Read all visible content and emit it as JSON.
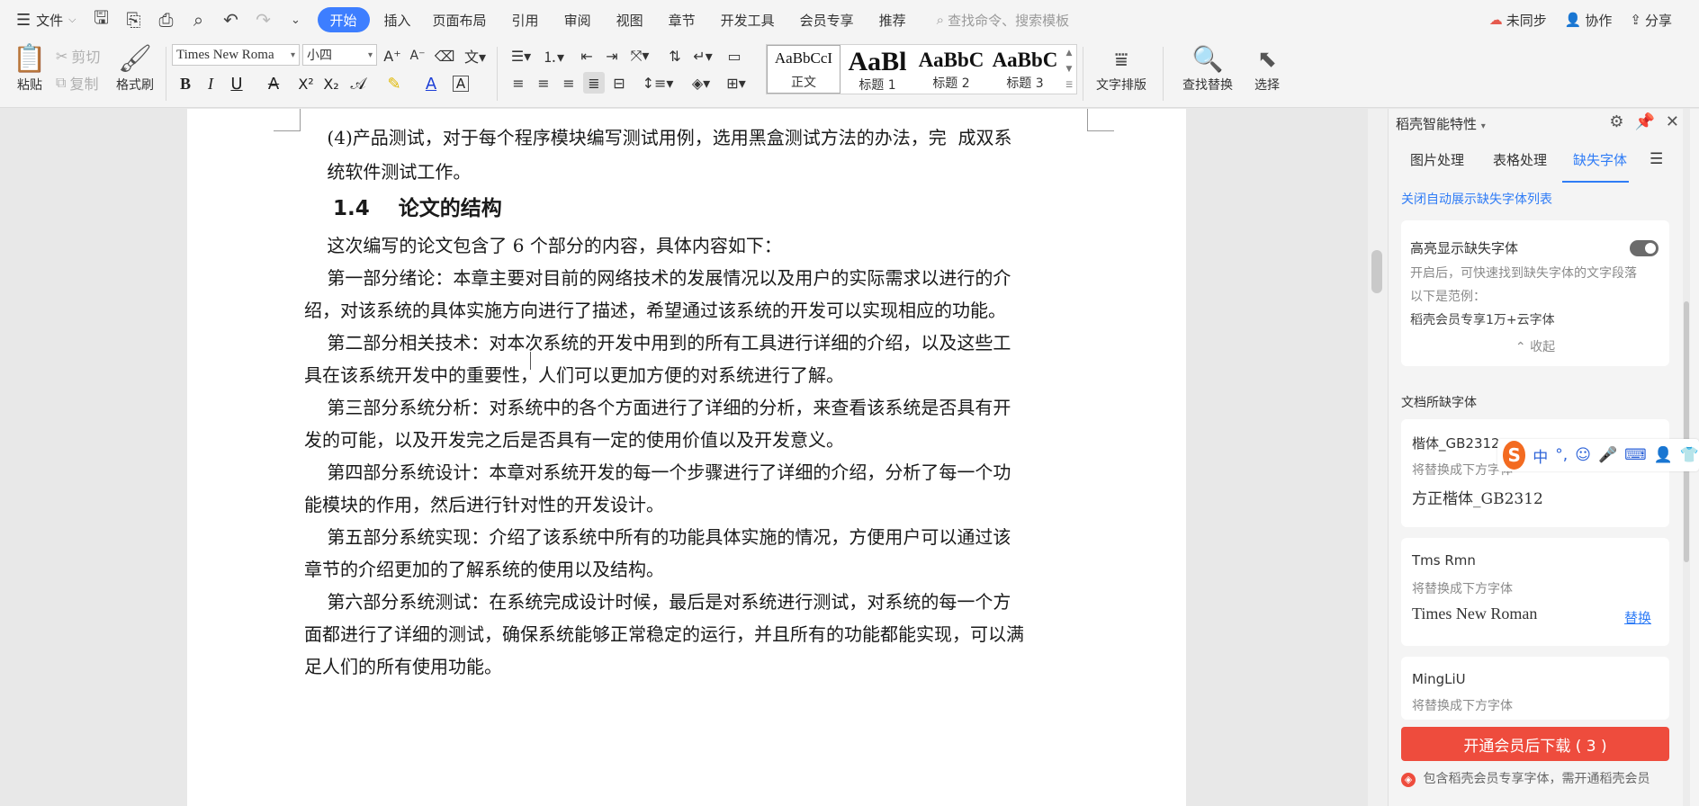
{
  "menubar": {
    "file_label": "文件",
    "tabs": [
      "开始",
      "插入",
      "页面布局",
      "引用",
      "审阅",
      "视图",
      "章节",
      "开发工具",
      "会员专享",
      "推荐"
    ],
    "search_placeholder": "查找命令、搜索模板",
    "sync_label": "未同步",
    "collab_label": "协作",
    "share_label": "分享"
  },
  "ribbon": {
    "paste_label": "粘贴",
    "cut_label": "剪切",
    "copy_label": "复制",
    "format_painter_label": "格式刷",
    "font_name": "Times New Roma",
    "font_size": "小四",
    "styles": [
      {
        "sample": "AaBbCcI",
        "name": "正文"
      },
      {
        "sample": "AaBl",
        "name": "标题 1"
      },
      {
        "sample": "AaBbC",
        "name": "标题 2"
      },
      {
        "sample": "AaBbC",
        "name": "标题 3"
      }
    ],
    "text_layout_label": "文字排版",
    "find_replace_label": "查找替换",
    "select_label": "选择"
  },
  "document": {
    "paragraphs": [
      "    (4)产品测试，对于每个程序模块编写测试用例，选用黑盒测试方法的办法，完  成双系",
      "    统软件测试工作。",
      "    1.4    论文的结构",
      "    这次编写的论文包含了 6 个部分的内容，具体内容如下：",
      "    第一部分绪论：本章主要对目前的网络技术的发展情况以及用户的实际需求以进行的介",
      "绍，对该系统的具体实施方向进行了描述，希望通过该系统的开发可以实现相应的功能。",
      "    第二部分相关技术：对本次系统的开发中用到的所有工具进行详细的介绍，以及这些工",
      "具在该系统开发中的重要性，人们可以更加方便的对系统进行了解。",
      "    第三部分系统分析：对系统中的各个方面进行了详细的分析，来查看该系统是否具有开",
      "发的可能，以及开发完之后是否具有一定的使用价值以及开发意义。",
      "    第四部分系统设计：本章对系统开发的每一个步骤进行了详细的介绍，分析了每一个功",
      "能模块的作用，然后进行针对性的开发设计。",
      "    第五部分系统实现：介绍了该系统中所有的功能具体实施的情况，方便用户可以通过该",
      "章节的介绍更加的了解系统的使用以及结构。",
      "    第六部分系统测试：在系统完成设计时候，最后是对系统进行测试，对系统的每一个方",
      "面都进行了详细的测试，确保系统能够正常稳定的运行，并且所有的功能都能实现，可以满",
      "足人们的所有使用功能。"
    ]
  },
  "pane": {
    "title": "稻壳智能特性",
    "tabs": [
      "图片处理",
      "表格处理",
      "缺失字体"
    ],
    "close_auto_link": "关闭自动展示缺失字体列表",
    "highlight_title": "高亮显示缺失字体",
    "highlight_desc": "开启后，可快速找到缺失字体的文字段落",
    "example_label": "以下是范例：",
    "example_text": "稻壳会员专享1万+云字体",
    "collapse_label": "收起",
    "missing_header": "文档所缺字体",
    "fonts": [
      {
        "missing": "楷体_GB2312",
        "hint": "将替换成下方字体",
        "replacement": "方正楷体_GB2312",
        "action": ""
      },
      {
        "missing": "Tms Rmn",
        "hint": "将替换成下方字体",
        "replacement": "Times New Roman",
        "action": "替换"
      },
      {
        "missing": "MingLiU",
        "hint": "将替换成下方字体",
        "replacement": "",
        "action": ""
      }
    ],
    "cta_label": "开通会员后下载 ( 3 )",
    "footer_note": "包含稻壳会员专享字体，需开通稻壳会员"
  },
  "ime": {
    "mode": "中",
    "punct": "°,"
  }
}
